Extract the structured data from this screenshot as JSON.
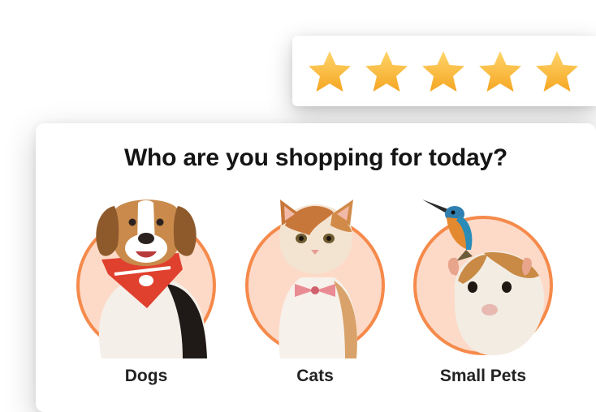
{
  "rating": {
    "stars": 5,
    "max": 5,
    "star_color": "#FDB52E",
    "star_highlight": "#FFD66B",
    "icon": "star-icon"
  },
  "main": {
    "title": "Who are you shopping for today?",
    "accent_color": "#F58A4B",
    "circle_fill": "#FDDAC8",
    "categories": [
      {
        "label": "Dogs",
        "icon": "dog-photo"
      },
      {
        "label": "Cats",
        "icon": "cat-photo"
      },
      {
        "label": "Small Pets",
        "icon": "small-pets-photo"
      }
    ]
  }
}
